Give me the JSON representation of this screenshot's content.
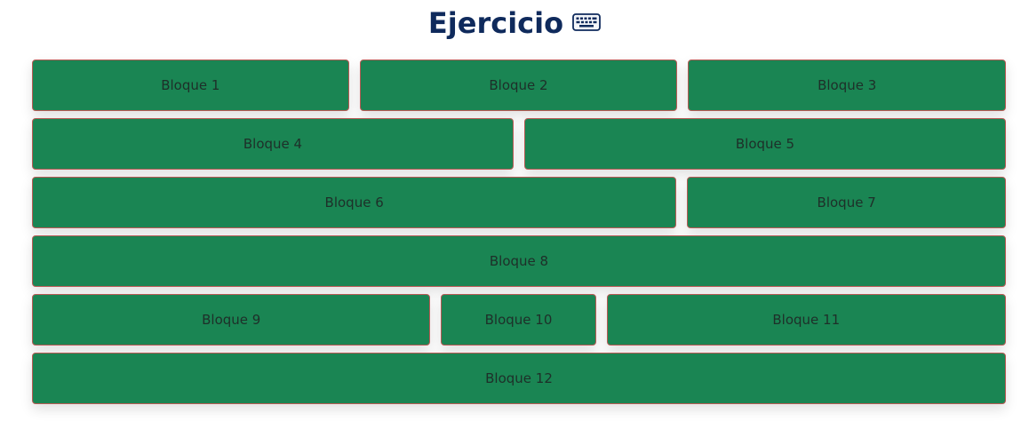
{
  "page": {
    "title": "Ejercicio",
    "title_icon": "keyboard-icon",
    "title_color": "#0f2a5c"
  },
  "colors": {
    "block_fill": "#1a8553",
    "block_border": "#b85a55",
    "block_text": "#1e2f29"
  },
  "rows": [
    [
      {
        "label": "Bloque 1"
      },
      {
        "label": "Bloque 2"
      },
      {
        "label": "Bloque 3"
      }
    ],
    [
      {
        "label": "Bloque 4"
      },
      {
        "label": "Bloque 5"
      }
    ],
    [
      {
        "label": "Bloque 6"
      },
      {
        "label": "Bloque 7"
      }
    ],
    [
      {
        "label": "Bloque 8"
      }
    ],
    [
      {
        "label": "Bloque 9"
      },
      {
        "label": "Bloque 10"
      },
      {
        "label": "Bloque 11"
      }
    ],
    [
      {
        "label": "Bloque 12"
      }
    ]
  ]
}
